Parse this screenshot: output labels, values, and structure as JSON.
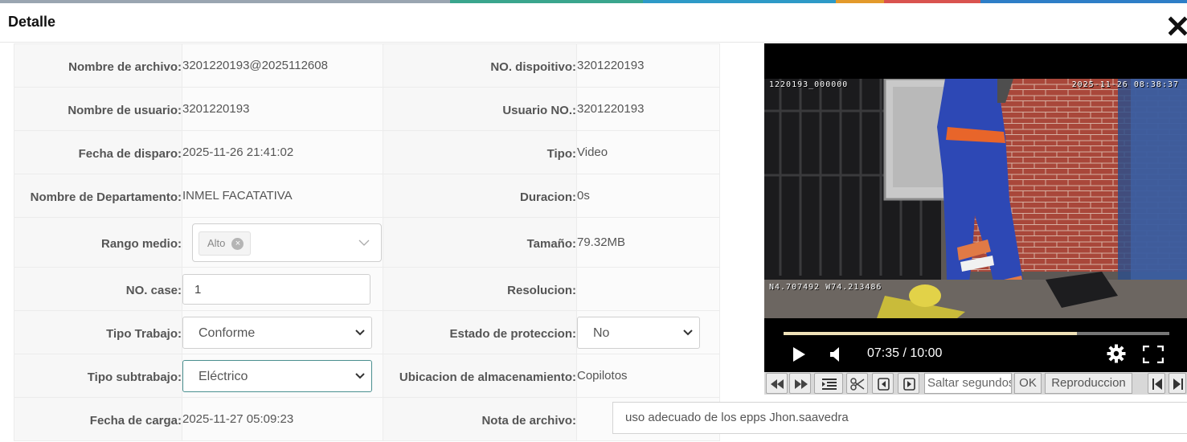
{
  "dialog": {
    "title": "Detalle"
  },
  "fields": {
    "file_name": {
      "label": "Nombre de archivo:",
      "value": "3201220193@2025112608"
    },
    "device_no": {
      "label": "NO. dispoitivo:",
      "value": "3201220193"
    },
    "user_name": {
      "label": "Nombre de usuario:",
      "value": "3201220193"
    },
    "user_no": {
      "label": "Usuario NO.:",
      "value": "3201220193"
    },
    "trigger_date": {
      "label": "Fecha de disparo:",
      "value": "2025-11-26 21:41:02"
    },
    "type": {
      "label": "Tipo:",
      "value": "Video"
    },
    "department": {
      "label": "Nombre de Departamento:",
      "value": "INMEL FACATATIVA"
    },
    "duration": {
      "label": "Duracion:",
      "value": "0s"
    },
    "range": {
      "label": "Rango medio:",
      "tag": "Alto",
      "tag_remove": "×"
    },
    "size": {
      "label": "Tamaño:",
      "value": "79.32MB"
    },
    "case_no": {
      "label": "NO. case:",
      "value": "1"
    },
    "resolution": {
      "label": "Resolucion:",
      "value": ""
    },
    "work_type": {
      "label": "Tipo Trabajo:",
      "value": "Conforme"
    },
    "protection": {
      "label": "Estado de proteccion:",
      "value": "No"
    },
    "sub_work_type": {
      "label": "Tipo subtrabajo:",
      "value": "Eléctrico"
    },
    "storage": {
      "label": "Ubicacion de almacenamiento:",
      "value": "Copilotos"
    },
    "upload_date": {
      "label": "Fecha de carga:",
      "value": "2025-11-27 05:09:23"
    },
    "note": {
      "label": "Nota de archivo:",
      "value": "uso adecuado de los epps Jhon.saavedra"
    }
  },
  "video": {
    "osd_id": "1220193_000000",
    "osd_datetime": "2025-11-26 08:38:37",
    "osd_gps": "N4.707492 W74.213486",
    "current_time": "07:35",
    "total_time": "10:00",
    "time_display": "07:35 / 10:00",
    "progress": 0.76
  },
  "toolbar": {
    "seek_placeholder": "Saltar segundos",
    "ok_label": "OK",
    "playback_label": "Reproduccion"
  },
  "icons": {
    "close": "close-icon",
    "play": "play-icon",
    "volume": "volume-icon",
    "settings": "gear-icon",
    "fullscreen": "fullscreen-icon"
  },
  "colors": {
    "accent_border": "#4a8f8f",
    "progress_fill": "#efe1b8",
    "label_bg": "#f7f7f7"
  }
}
